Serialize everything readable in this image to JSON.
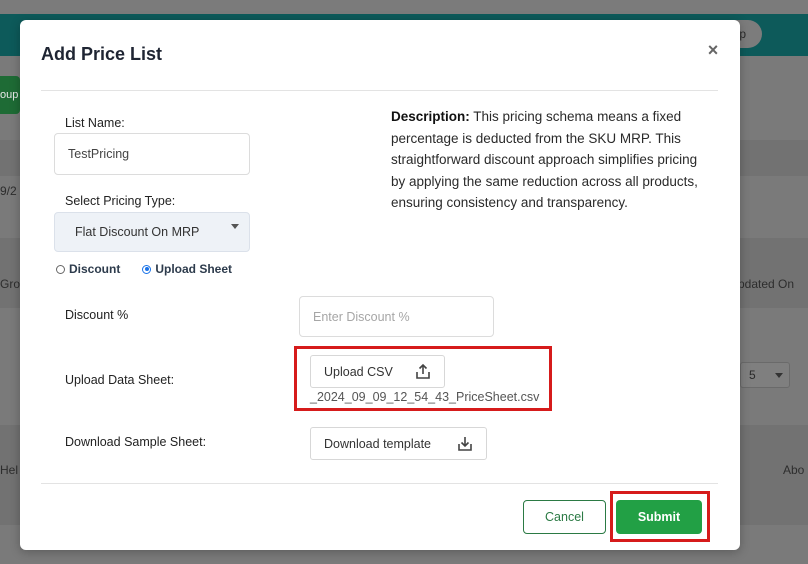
{
  "background": {
    "tab_pill_label": "p",
    "left_button_label": "oup",
    "date_fragment": "9/2",
    "group_fragment": "Grou",
    "updated_on_label": "pdated On",
    "help_fragment": "Hel",
    "about_fragment": "Abo",
    "rows_per_page": "5"
  },
  "modal": {
    "title": "Add Price List",
    "close_symbol": "×",
    "list_name": {
      "label": "List Name:",
      "value": "TestPricing"
    },
    "pricing_type": {
      "label": "Select Pricing Type:",
      "selected": "Flat Discount On MRP"
    },
    "mode_options": {
      "discount_label": "Discount",
      "upload_label": "Upload Sheet",
      "selected": "Upload Sheet"
    },
    "description": {
      "heading": "Description:",
      "text": " This pricing schema means a fixed percentage is deducted from the SKU MRP. This straightforward discount approach simplifies pricing by applying the same reduction across all products, ensuring consistency and transparency."
    },
    "discount_percent": {
      "label": "Discount %",
      "placeholder": "Enter Discount %"
    },
    "upload_data_sheet": {
      "label": "Upload Data Sheet:",
      "button_label": "Upload CSV",
      "file_name": "_2024_09_09_12_54_43_PriceSheet.csv"
    },
    "download_sample": {
      "label": "Download Sample Sheet:",
      "button_label": "Download template"
    },
    "footer": {
      "cancel_label": "Cancel",
      "submit_label": "Submit"
    }
  },
  "colors": {
    "primary_green": "#22a045",
    "outline_green": "#2b7a44",
    "highlight_red": "#d61b1b",
    "background_teal": "#0d5a5a",
    "radio_blue": "#1a73e8"
  },
  "icons": {
    "upload": "upload-icon",
    "download": "download-icon",
    "close": "close-icon",
    "dropdown": "chevron-down-icon"
  }
}
